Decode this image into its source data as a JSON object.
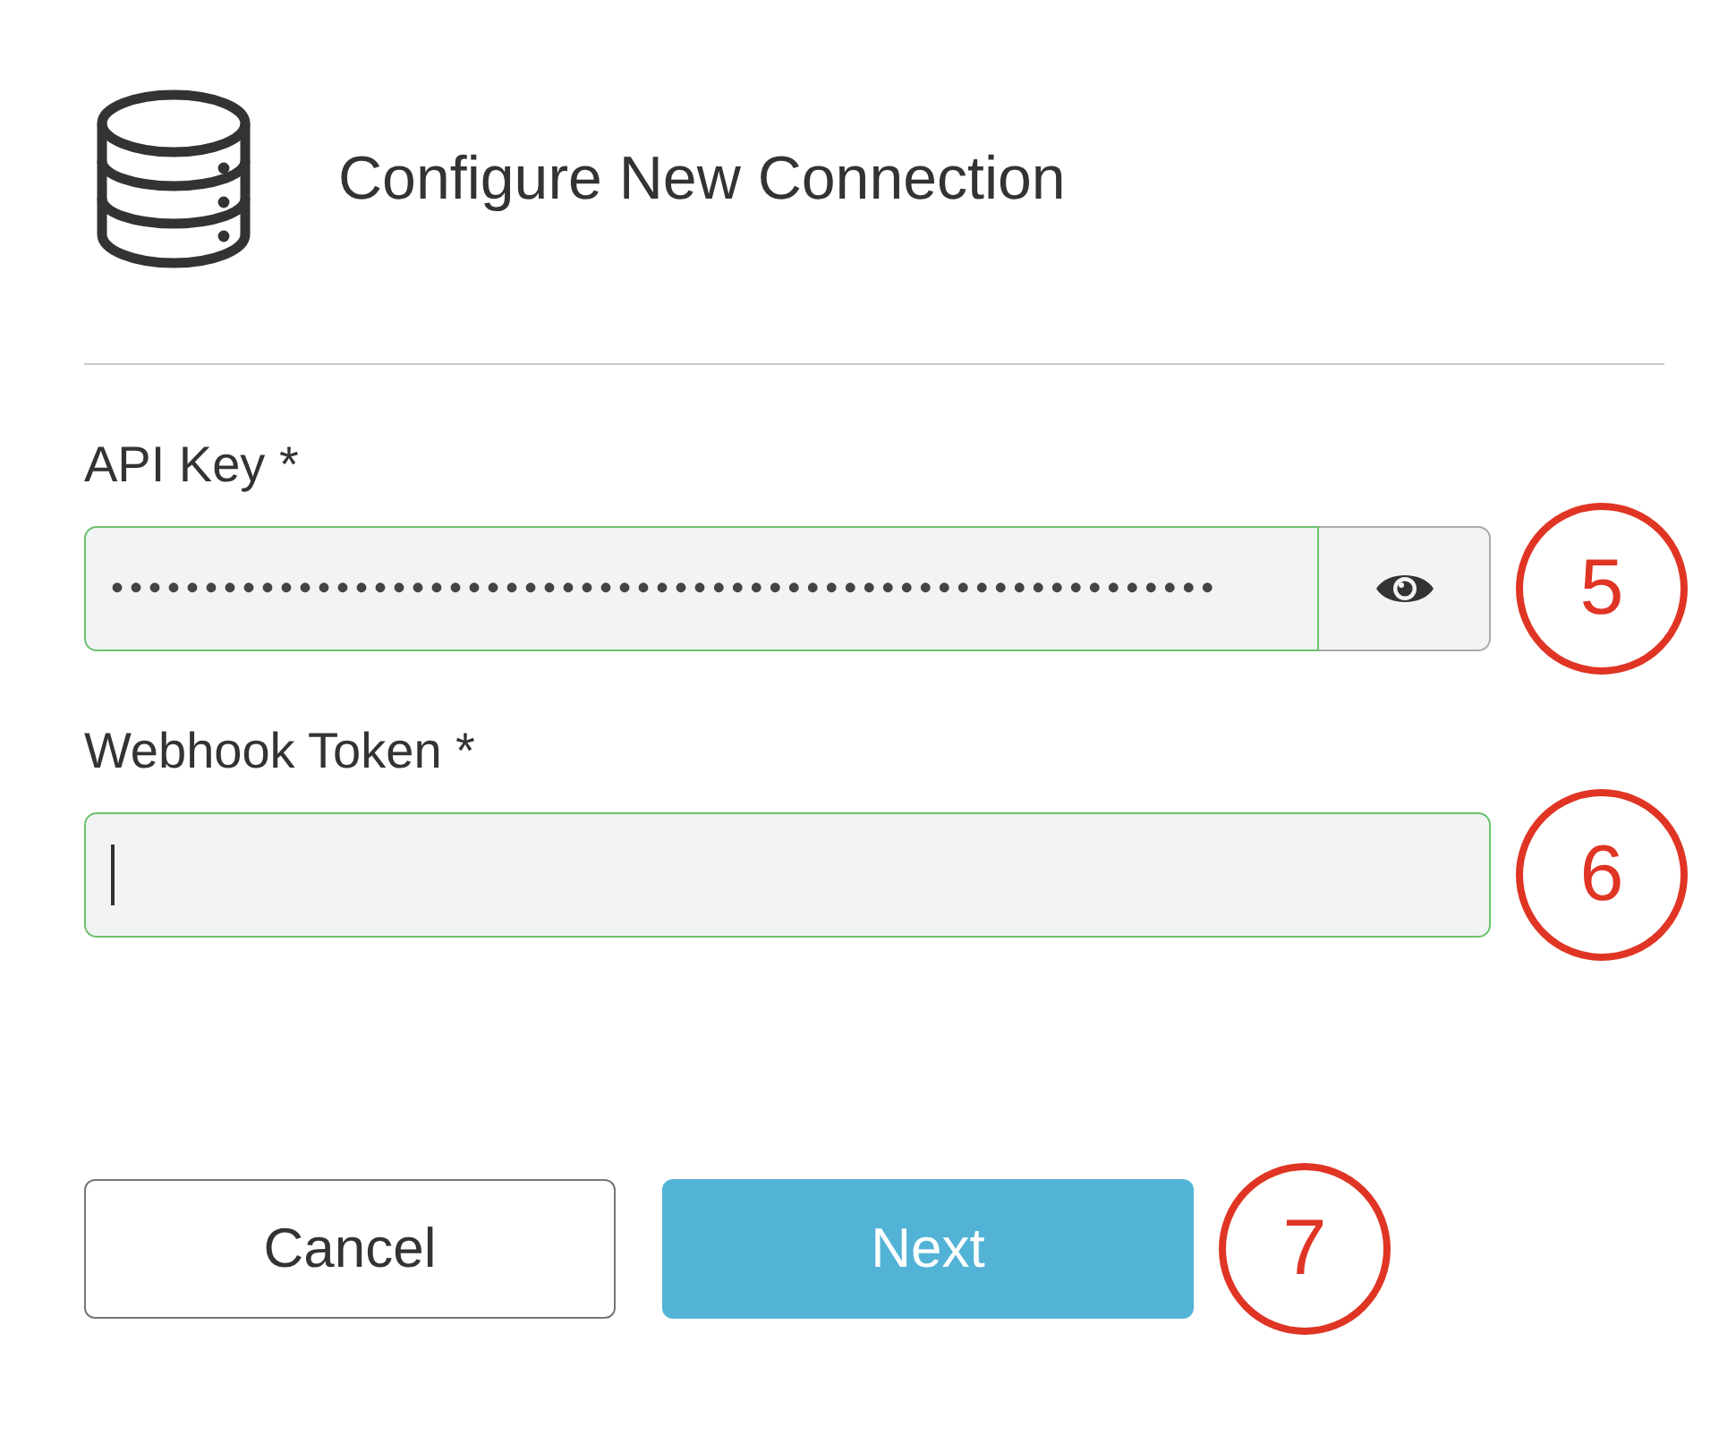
{
  "dialog": {
    "title": "Configure New Connection"
  },
  "fields": [
    {
      "label": "API Key *",
      "kind": "secret",
      "value": "•••••••••••••••••••••••••••••••••••••••••••••••••••••••••••",
      "focused": false,
      "callout": "5"
    },
    {
      "label": "Webhook Token *",
      "kind": "text",
      "focused": true,
      "callout": "6"
    }
  ],
  "buttons": [
    {
      "label": "Cancel",
      "kind": "secondary"
    },
    {
      "label": "Next",
      "kind": "primary",
      "callout": "7"
    }
  ]
}
